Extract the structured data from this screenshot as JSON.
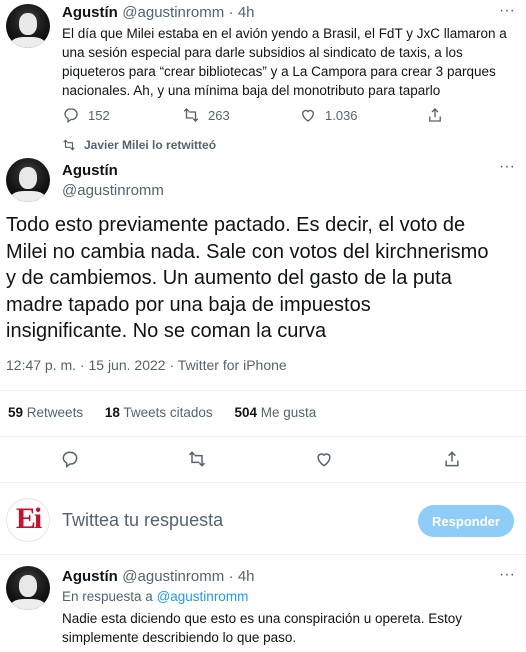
{
  "tweet1": {
    "name": "Agustín",
    "handle": "@agustinromm",
    "time": "· 4h",
    "text_line1": "El día que Milei estaba en el avión yendo a Brasil, el FdT y JxC llamaron a",
    "text_line2": "una sesión especial para darle subsidios al sindicato de taxis, a los",
    "text_line3": "piqueteros para “crear bibliotecas” y a La Campora para crear 3 parques",
    "text_line4": "nacionales. Ah, y una mínima baja del monotributo para taparlo",
    "replies": "152",
    "retweets": "263",
    "likes": "1.036"
  },
  "retweet_note": "Javier Milei lo retwitteó",
  "main_tweet": {
    "name": "Agustín",
    "handle": "@agustinromm",
    "text_line1": "Todo esto previamente pactado. Es decir, el voto de",
    "text_line2": "Milei no cambia nada. Sale con votos del kirchnerismo",
    "text_line3": "y de cambiemos. Un aumento del gasto de la puta",
    "text_line4": "madre tapado por una baja de impuestos",
    "text_line5": "insignificante. No se coman la curva",
    "timestamp": "12:47 p. m. · 15 jun. 2022 · Twitter for iPhone",
    "retweets_num": "59",
    "retweets_label": "Retweets",
    "quotes_num": "18",
    "quotes_label": "Tweets citados",
    "likes_num": "504",
    "likes_label": "Me gusta"
  },
  "composer": {
    "logo_text": "Ei",
    "placeholder": "Twittea tu respuesta",
    "button": "Responder"
  },
  "reply_tweet": {
    "name": "Agustín",
    "handle": "@agustinromm",
    "time": "· 4h",
    "in_reply_prefix": "En respuesta a",
    "in_reply_to": "@agustinromm",
    "text_line1": "Nadie esta diciendo que esto es una conspiración u opereta. Estoy",
    "text_line2": "simplemente describiendo lo que paso."
  },
  "colors": {
    "accent": "#1d9bf0",
    "button_disabled": "#8ecdf8",
    "secondary_text": "#536471",
    "logo_red": "#c8102e"
  }
}
